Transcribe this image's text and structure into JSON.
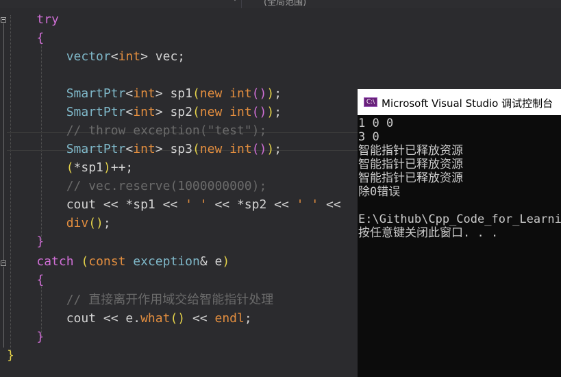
{
  "toolbar": {
    "scope_label": "(全局范围)",
    "dropdown_arrow": "chevron-down-icon"
  },
  "code_lines": [
    [
      "try"
    ],
    [
      "{"
    ],
    [
      ""
    ],
    [
      "vector<int> vec;"
    ],
    [
      ""
    ],
    [
      "SmartPtr<int> sp1(new int());"
    ],
    [
      "SmartPtr<int> sp2(new int());"
    ],
    [
      "// throw exception(\"test\");"
    ],
    [
      "SmartPtr<int> sp3(new int());"
    ],
    [
      "(*sp1)++;"
    ],
    [
      "// vec.reserve(1000000000);"
    ],
    [
      "cout << *sp1 << ' ' << *sp2 << ' ' <<"
    ],
    [
      "div();"
    ],
    [
      "}"
    ],
    [
      "catch (const exception& e)"
    ],
    [
      "{"
    ],
    [
      "// 直接离开作用域交给智能指针处理"
    ],
    [
      "cout << e.what() << endl;"
    ],
    [
      "}"
    ],
    [
      "}"
    ]
  ],
  "code": {
    "l01_kw": "try",
    "l02_brace": "{",
    "l04_type": "vector",
    "l04_lt": "<",
    "l04_int": "int",
    "l04_rest": "> vec;",
    "l06_type": "SmartPtr",
    "l06_lt": "<",
    "l06_int": "int",
    "l06_gt": "> sp1",
    "l06_p1": "(",
    "l06_new": "new",
    "l06_int2": "int",
    "l06_p2": "()",
    "l06_p3": ")",
    "l06_semi": ";",
    "l07_type": "SmartPtr",
    "l07_lt": "<",
    "l07_int": "int",
    "l07_gt": "> sp2",
    "l07_p1": "(",
    "l07_new": "new",
    "l07_int2": "int",
    "l07_p2": "()",
    "l07_p3": ")",
    "l07_semi": ";",
    "l08_comment": "// throw exception(\"test\");",
    "l09_type": "SmartPtr",
    "l09_lt": "<",
    "l09_int": "int",
    "l09_gt": "> sp3",
    "l09_p1": "(",
    "l09_new": "new",
    "l09_int2": "int",
    "l09_p2": "()",
    "l09_p3": ")",
    "l09_semi": ";",
    "l10_p1": "(",
    "l10_mid": "*sp1",
    "l10_p2": ")",
    "l10_rest": "++;",
    "l11_comment": "// vec.reserve(1000000000);",
    "l12_a": "cout << *sp1 << ",
    "l12_ch1": "' '",
    "l12_b": " << *sp2 << ",
    "l12_ch2": "' '",
    "l12_c": " <<",
    "l13_fn": "div",
    "l13_p": "()",
    "l13_semi": ";",
    "l14_brace": "}",
    "l15_kw": "catch",
    "l15_p1": " (",
    "l15_const": "const",
    "l15_sp": " ",
    "l15_type": "exception",
    "l15_amp": "& e",
    "l15_p2": ")",
    "l16_brace": "{",
    "l17_comment": "// 直接离开作用域交给智能指针处理",
    "l18_a": "cout << e.",
    "l18_fn": "what",
    "l18_p": "()",
    "l18_b": " << ",
    "l18_endl": "endl",
    "l18_semi": ";",
    "l19_brace": "}",
    "l20_brace": "}"
  },
  "console": {
    "title": "Microsoft Visual Studio 调试控制台",
    "icon": "vs-debug-console-icon",
    "icon_text": "C:\\",
    "lines": [
      "1 0 0",
      "3 0",
      "智能指针已释放资源",
      "智能指针已释放资源",
      "智能指针已释放资源",
      "除0错误",
      "",
      "E:\\Github\\Cpp_Code_for_Learning",
      "按任意键关闭此窗口. . ."
    ]
  },
  "colors": {
    "editor_bg": "#2b2b2e",
    "keyword": "#d06fd6",
    "type": "#7fb8c9",
    "builtin": "#e38e3f",
    "bracket": "#e4d24a",
    "comment": "#6a6a6a",
    "console_bg": "#0c0c0c"
  }
}
